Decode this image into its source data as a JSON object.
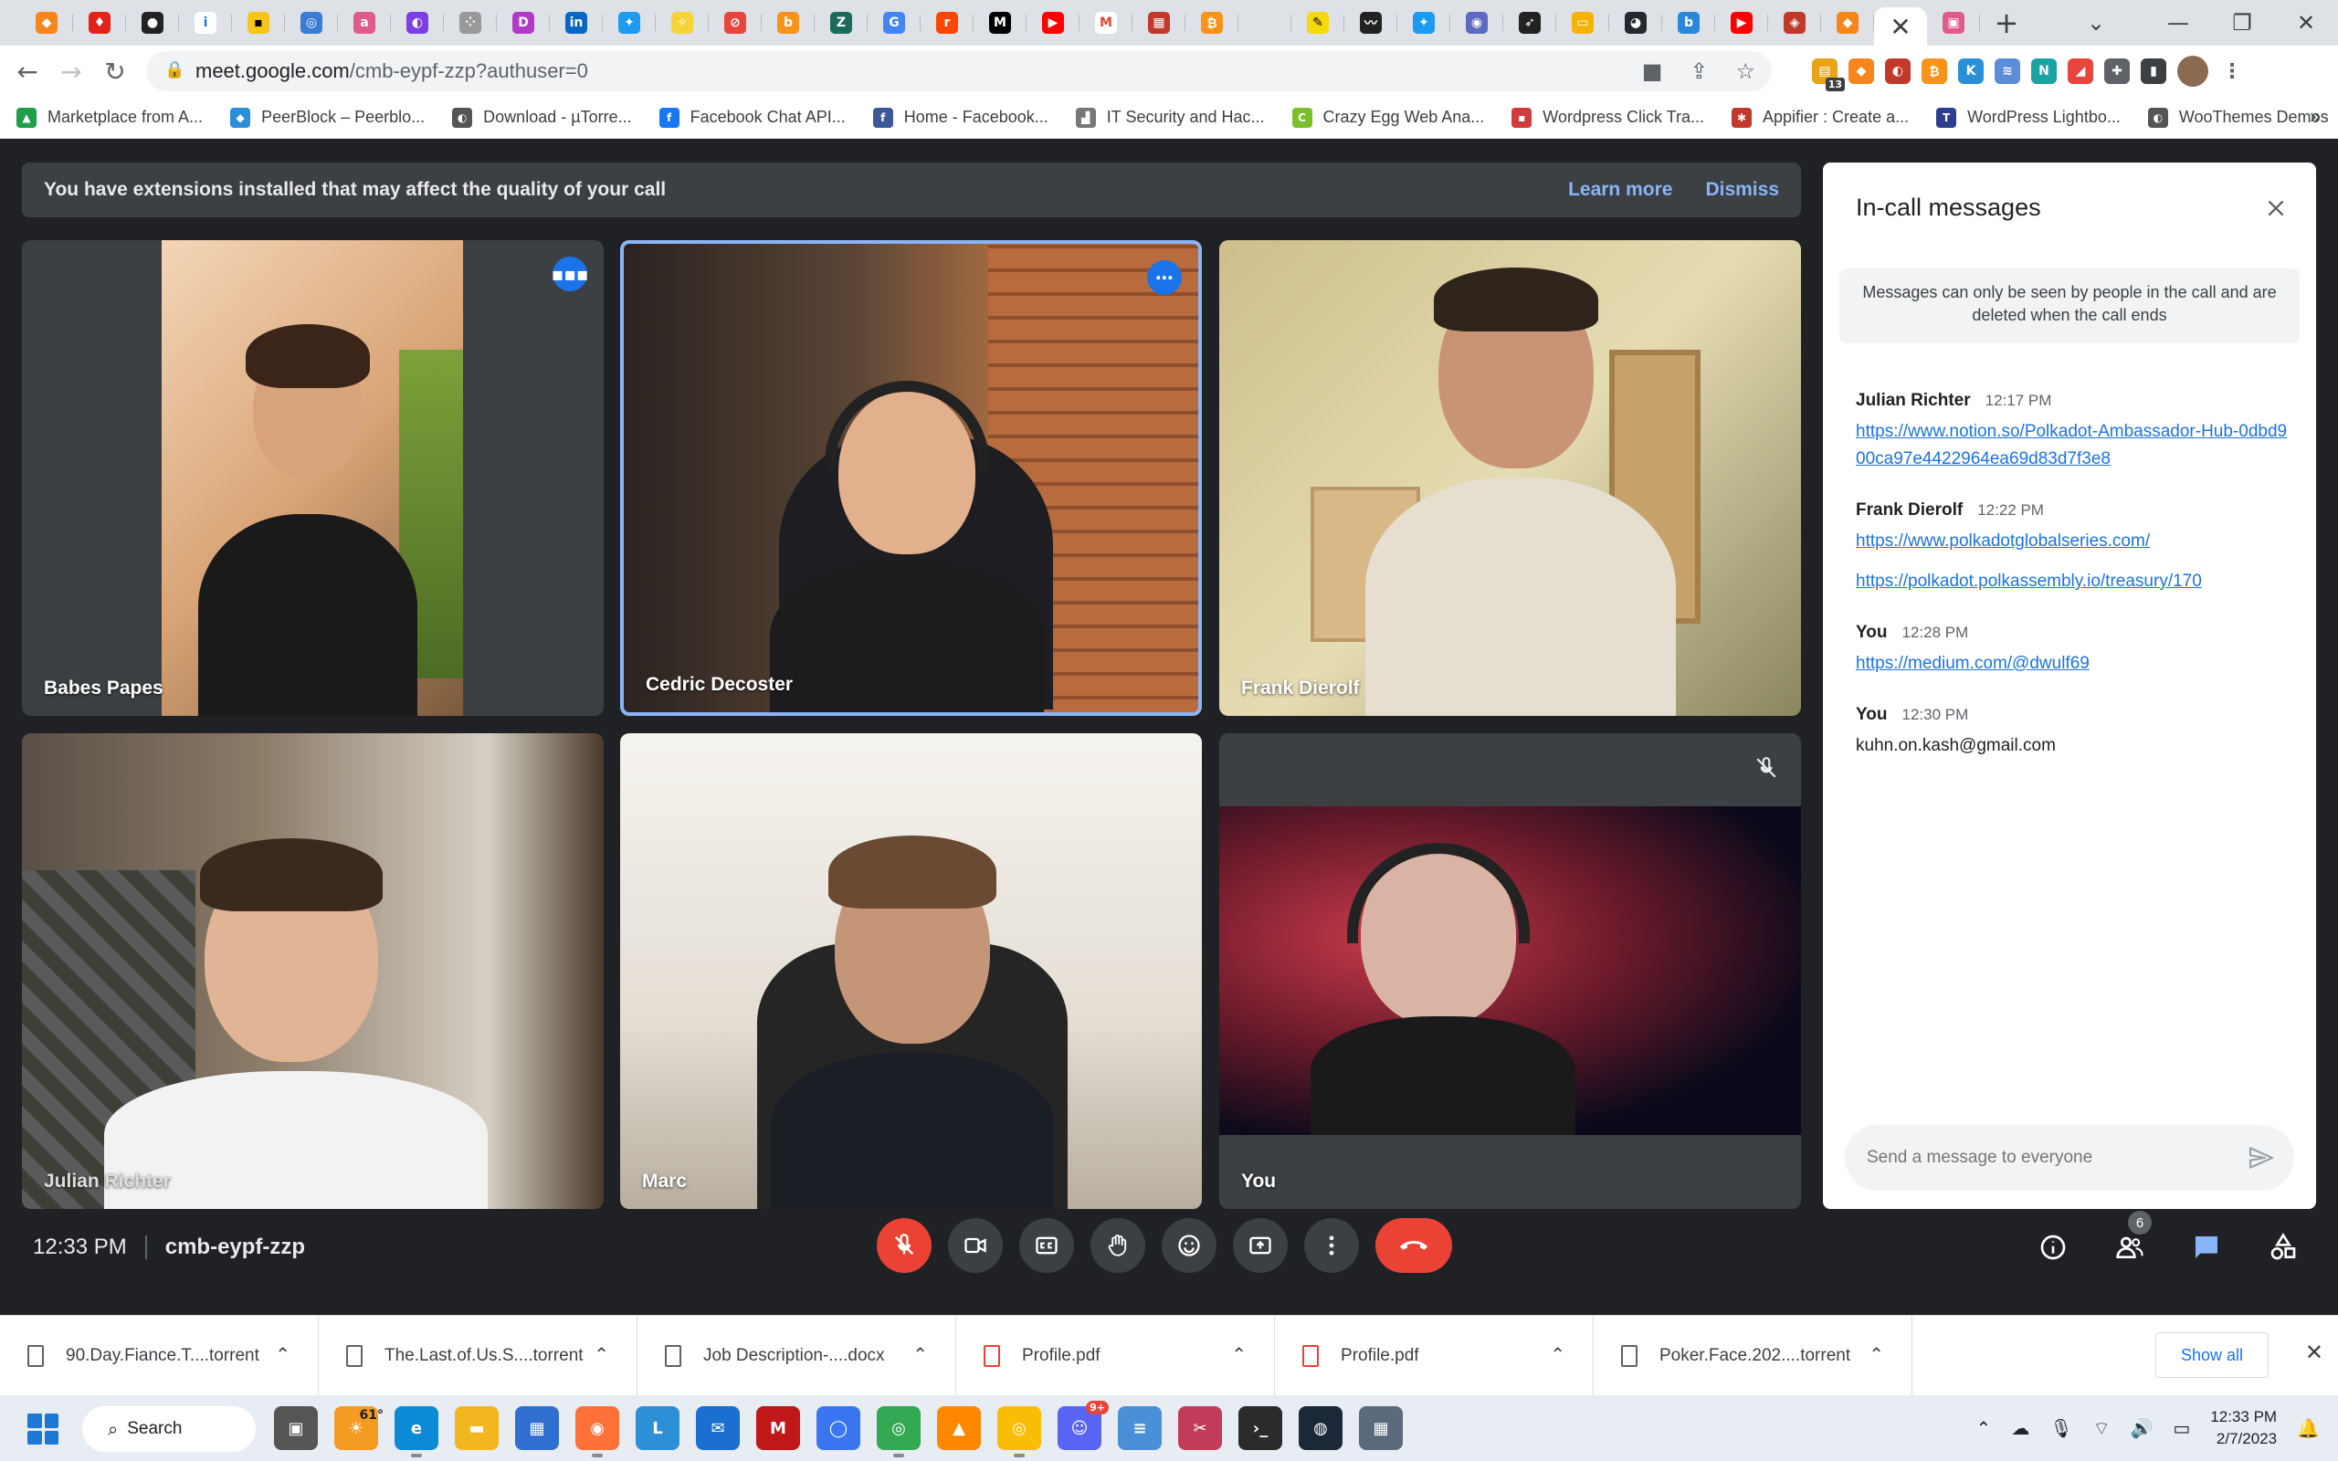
{
  "browser": {
    "close_tab": "✕",
    "new_tab": "+",
    "address": {
      "host": "meet.google.com",
      "path": "/cmb-eypf-zzp?authuser=0"
    },
    "extension_badge": "13",
    "bookmarks": [
      {
        "label": "Marketplace from A...",
        "color": "#1f9f4a"
      },
      {
        "label": "PeerBlock – Peerblo...",
        "color": "#2a8fd6"
      },
      {
        "label": "Download - µTorre...",
        "color": "#555555"
      },
      {
        "label": "Facebook Chat API...",
        "color": "#1877f2"
      },
      {
        "label": "Home - Facebook...",
        "color": "#3b5998"
      },
      {
        "label": "IT Security and Hac...",
        "color": "#777777"
      },
      {
        "label": "Crazy Egg Web Ana...",
        "color": "#7cbf2a"
      },
      {
        "label": "Wordpress Click Tra...",
        "color": "#d23b3b"
      },
      {
        "label": "Appifier : Create a...",
        "color": "#c0392b"
      },
      {
        "label": "WordPress Lightbo...",
        "color": "#2c3e8f"
      },
      {
        "label": "WooThemes Demos",
        "color": "#555555"
      }
    ]
  },
  "meet": {
    "banner": {
      "message": "You have extensions installed that may affect the quality of your call",
      "learn_more": "Learn more",
      "dismiss": "Dismiss"
    },
    "participants": [
      {
        "name": "Babes Papes"
      },
      {
        "name": "Cedric Decoster"
      },
      {
        "name": "Frank Dierolf"
      },
      {
        "name": "Julian Richter"
      },
      {
        "name": "Marc"
      },
      {
        "name": "You"
      }
    ],
    "time": "12:33 PM",
    "meeting_code": "cmb-eypf-zzp",
    "participant_count": "6",
    "chat": {
      "title": "In-call messages",
      "info": "Messages can only be seen by people in the call and are deleted when the call ends",
      "messages": [
        {
          "sender": "Julian Richter",
          "time": "12:17 PM",
          "lines": [
            "https://www.notion.so/Polkadot-Ambassador-Hub-0dbd900ca97e4422964ea69d83d7f3e8"
          ]
        },
        {
          "sender": "Frank Dierolf",
          "time": "12:22 PM",
          "lines": [
            "https://www.polkadotglobalseries.com/",
            "https://polkadot.polkassembly.io/treasury/170"
          ]
        },
        {
          "sender": "You",
          "time": "12:28 PM",
          "lines": [
            "https://medium.com/@dwulf69"
          ]
        },
        {
          "sender": "You",
          "time": "12:30 PM",
          "lines": [
            "kuhn.on.kash@gmail.com"
          ]
        }
      ],
      "input_placeholder": "Send a message to everyone"
    }
  },
  "downloads": {
    "items": [
      {
        "name": "90.Day.Fiance.T....torrent",
        "type": "file"
      },
      {
        "name": "The.Last.of.Us.S....torrent",
        "type": "file"
      },
      {
        "name": "Job Description-....docx",
        "type": "file"
      },
      {
        "name": "Profile.pdf",
        "type": "pdf"
      },
      {
        "name": "Profile.pdf",
        "type": "pdf"
      },
      {
        "name": "Poker.Face.202....torrent",
        "type": "file"
      }
    ],
    "show_all": "Show all"
  },
  "taskbar": {
    "search_label": "Search",
    "weather": "61°",
    "notification_badge": "9+",
    "time": "12:33 PM",
    "date": "2/7/2023"
  }
}
